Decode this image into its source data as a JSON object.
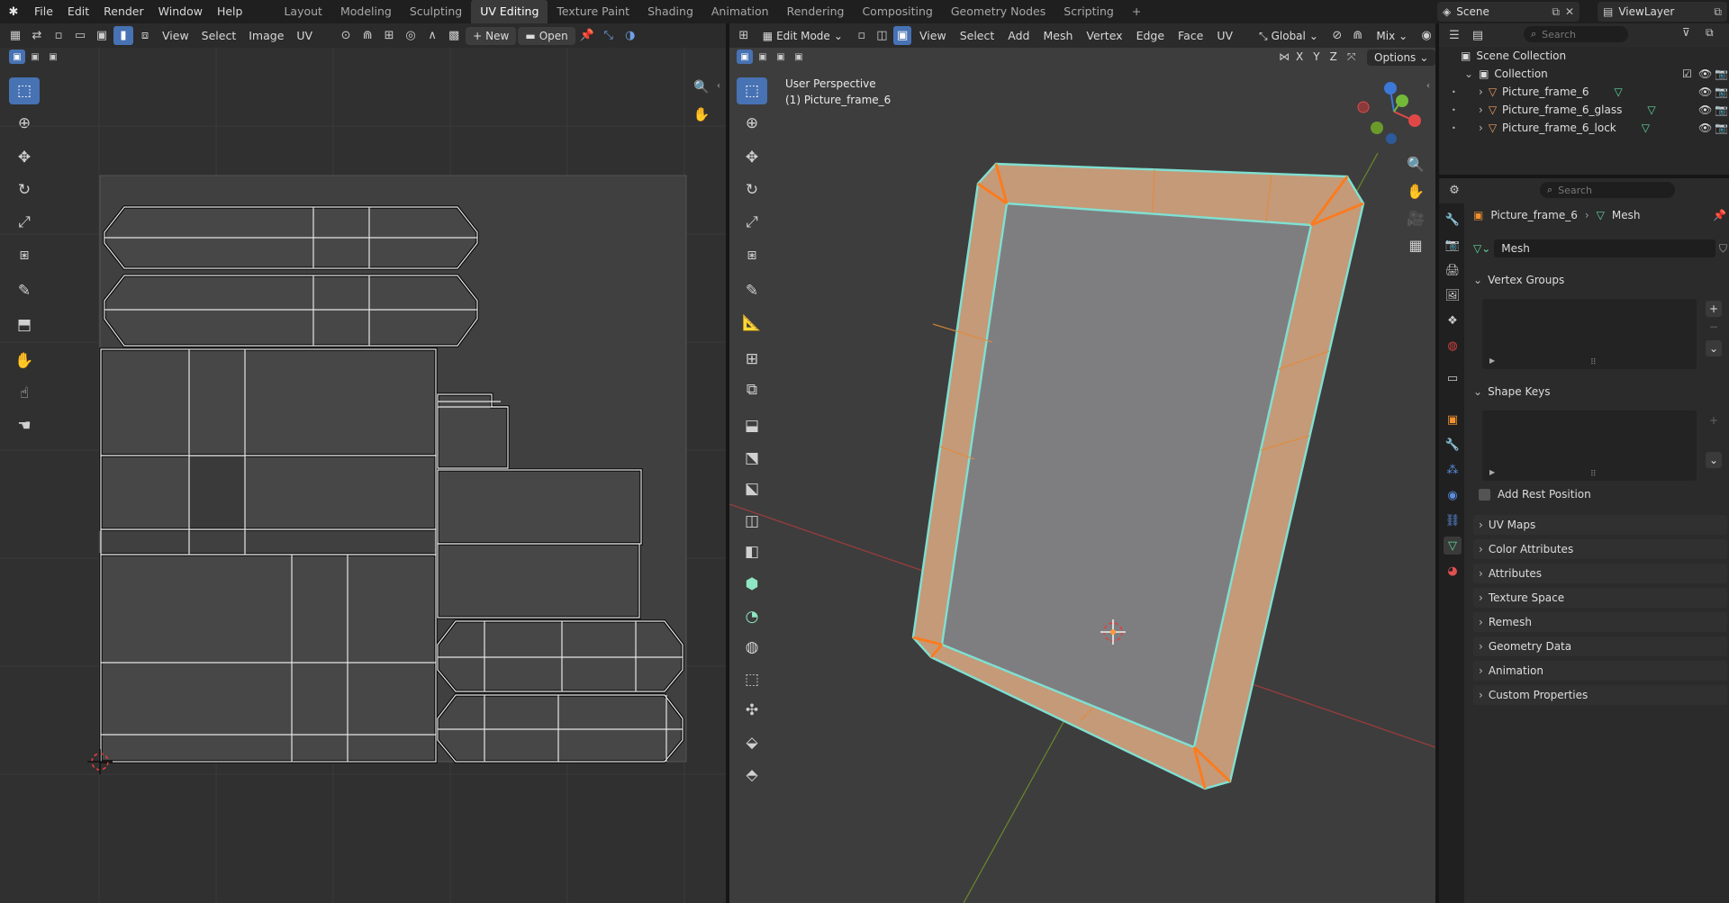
{
  "menu": {
    "file": "File",
    "edit": "Edit",
    "render": "Render",
    "window": "Window",
    "help": "Help"
  },
  "workspaces": [
    "Layout",
    "Modeling",
    "Sculpting",
    "UV Editing",
    "Texture Paint",
    "Shading",
    "Animation",
    "Rendering",
    "Compositing",
    "Geometry Nodes",
    "Scripting"
  ],
  "active_workspace": "UV Editing",
  "scene": {
    "label": "Scene",
    "viewlayer": "ViewLayer"
  },
  "uv_editor": {
    "menus": [
      "View",
      "Select",
      "Image",
      "UV"
    ],
    "new_label": "New",
    "open_label": "Open"
  },
  "viewport": {
    "mode": "Edit Mode",
    "menus": [
      "View",
      "Select",
      "Add",
      "Mesh",
      "Vertex",
      "Edge",
      "Face",
      "UV"
    ],
    "transform": "Global",
    "proportional": "Mix",
    "options_label": "Options",
    "axes": [
      "X",
      "Y",
      "Z"
    ],
    "overlay_title": "User Perspective",
    "overlay_object": "(1) Picture_frame_6"
  },
  "outliner": {
    "search_placeholder": "Search",
    "root": "Scene Collection",
    "collection": "Collection",
    "objects": [
      "Picture_frame_6",
      "Picture_frame_6_glass",
      "Picture_frame_6_lock"
    ]
  },
  "properties": {
    "search_placeholder": "Search",
    "breadcrumb_object": "Picture_frame_6",
    "breadcrumb_data": "Mesh",
    "mesh_name": "Mesh",
    "panels_open": [
      "Vertex Groups",
      "Shape Keys"
    ],
    "add_rest_position": "Add Rest Position",
    "panels_closed": [
      "UV Maps",
      "Color Attributes",
      "Attributes",
      "Texture Space",
      "Remesh",
      "Geometry Data",
      "Animation",
      "Custom Properties"
    ]
  },
  "colors": {
    "accent": "#4772b3",
    "frame_face": "#c49a78",
    "frame_edge": "#7fe0d2",
    "selected_edge": "#ff7a1a",
    "bg": "#3d3d3d"
  }
}
